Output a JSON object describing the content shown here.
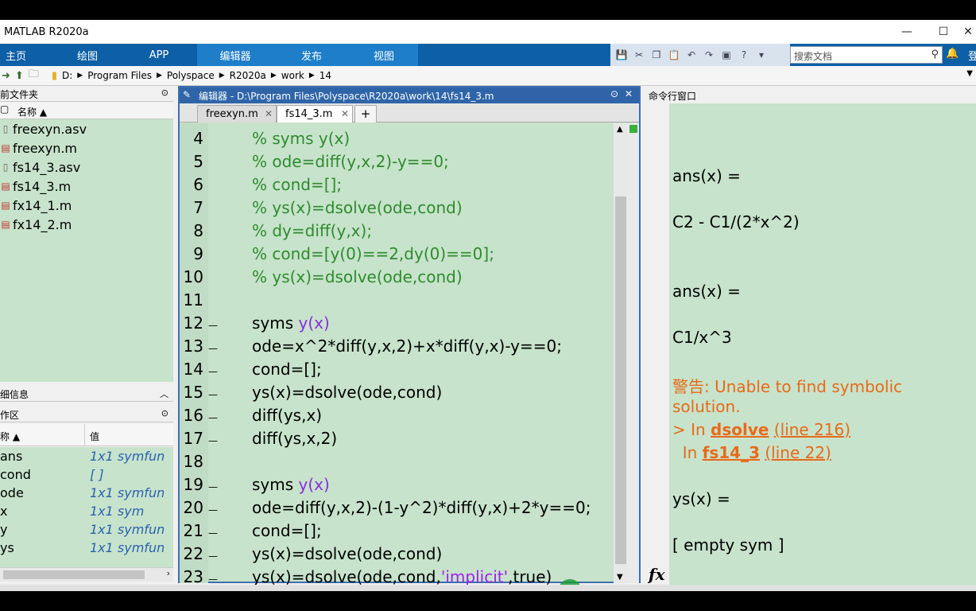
{
  "window": {
    "title": "MATLAB R2020a"
  },
  "ribbon": {
    "tabs": [
      "主页",
      "绘图",
      "APP",
      "编辑器",
      "发布",
      "视图"
    ],
    "active": 3,
    "search_placeholder": "搜索文档",
    "login": "登"
  },
  "address": {
    "crumbs": [
      "D:",
      "Program Files",
      "Polyspace",
      "R2020a",
      "work",
      "14"
    ]
  },
  "file_browser": {
    "title": "前文件夹",
    "column": "名称 ▲",
    "files": [
      "freexyn.asv",
      "freexyn.m",
      "fs14_3.asv",
      "fs14_3.m",
      "fx14_1.m",
      "fx14_2.m"
    ]
  },
  "details": {
    "title": "细信息"
  },
  "workspace": {
    "title": "作区",
    "col_name": "称 ▲",
    "col_value": "值",
    "vars": [
      {
        "name": "ans",
        "value": "1x1 symfun"
      },
      {
        "name": "cond",
        "value": "[ ]"
      },
      {
        "name": "ode",
        "value": "1x1 symfun"
      },
      {
        "name": "x",
        "value": "1x1 sym"
      },
      {
        "name": "y",
        "value": "1x1 symfun"
      },
      {
        "name": "ys",
        "value": "1x1 symfun"
      }
    ]
  },
  "editor": {
    "title": "编辑器 - D:\\Program Files\\Polyspace\\R2020a\\work\\14\\fs14_3.m",
    "tabs": [
      "freexyn.m",
      "fs14_3.m",
      "+"
    ],
    "active_tab": 1,
    "lines": [
      {
        "n": "4",
        "dash": "",
        "parts": [
          {
            "t": "% syms y(x)",
            "c": "cm"
          }
        ]
      },
      {
        "n": "5",
        "dash": "",
        "parts": [
          {
            "t": "% ode=diff(y,x,2)-y==0;",
            "c": "cm"
          }
        ]
      },
      {
        "n": "6",
        "dash": "",
        "parts": [
          {
            "t": "% cond=[];",
            "c": "cm"
          }
        ]
      },
      {
        "n": "7",
        "dash": "",
        "parts": [
          {
            "t": "% ys(x)=dsolve(ode,cond)",
            "c": "cm"
          }
        ]
      },
      {
        "n": "8",
        "dash": "",
        "parts": [
          {
            "t": "% dy=diff(y,x);",
            "c": "cm"
          }
        ]
      },
      {
        "n": "9",
        "dash": "",
        "parts": [
          {
            "t": "% cond=[y(0)==2,dy(0)==0];",
            "c": "cm"
          }
        ]
      },
      {
        "n": "10",
        "dash": "",
        "parts": [
          {
            "t": "% ys(x)=dsolve(ode,cond)",
            "c": "cm"
          }
        ]
      },
      {
        "n": "11",
        "dash": "",
        "parts": []
      },
      {
        "n": "12",
        "dash": "—",
        "parts": [
          {
            "t": "syms ",
            "c": ""
          },
          {
            "t": "y(x)",
            "c": "sv"
          }
        ]
      },
      {
        "n": "13",
        "dash": "—",
        "parts": [
          {
            "t": "ode=x^2*diff(y,x,2)+x*diff(y,x)-y==0;",
            "c": ""
          }
        ]
      },
      {
        "n": "14",
        "dash": "—",
        "parts": [
          {
            "t": "cond=[];",
            "c": ""
          }
        ]
      },
      {
        "n": "15",
        "dash": "—",
        "parts": [
          {
            "t": "ys(x)=dsolve(ode,cond)",
            "c": ""
          }
        ]
      },
      {
        "n": "16",
        "dash": "—",
        "parts": [
          {
            "t": "diff(ys,x)",
            "c": ""
          }
        ]
      },
      {
        "n": "17",
        "dash": "—",
        "parts": [
          {
            "t": "diff(ys,x,2)",
            "c": ""
          }
        ]
      },
      {
        "n": "18",
        "dash": "",
        "parts": []
      },
      {
        "n": "19",
        "dash": "—",
        "parts": [
          {
            "t": "syms ",
            "c": ""
          },
          {
            "t": "y(x)",
            "c": "sv"
          }
        ]
      },
      {
        "n": "20",
        "dash": "—",
        "parts": [
          {
            "t": "ode=diff(y,x,2)-(1-y^2)*diff(y,x)+2*y==0;",
            "c": ""
          }
        ]
      },
      {
        "n": "21",
        "dash": "—",
        "parts": [
          {
            "t": "cond=[];",
            "c": ""
          }
        ]
      },
      {
        "n": "22",
        "dash": "—",
        "parts": [
          {
            "t": "ys(x)=dsolve(ode,cond)",
            "c": ""
          }
        ]
      },
      {
        "n": "23",
        "dash": "—",
        "parts": [
          {
            "t": "ys(x)=dsolve(ode,cond,",
            "c": ""
          },
          {
            "t": "'implicit'",
            "c": "st"
          },
          {
            "t": ",true)",
            "c": ""
          }
        ]
      }
    ]
  },
  "command_window": {
    "title": "命令行窗口",
    "lines": [
      {
        "t": "ans(x) =",
        "c": ""
      },
      {
        "t": "C2 - C1/(2*x^2)",
        "c": ""
      },
      {
        "t": "ans(x) =",
        "c": ""
      },
      {
        "t": "C1/x^3",
        "c": ""
      },
      {
        "t": "警告: Unable to find symbolic",
        "c": "warn"
      },
      {
        "t": "solution.",
        "c": "warn"
      },
      {
        "t": "ys(x) =",
        "c": ""
      },
      {
        "t": "[ empty sym ]",
        "c": ""
      }
    ],
    "trace1": {
      "prefix": "> In ",
      "fn": "dsolve",
      "loc": "(line 216)"
    },
    "trace2": {
      "prefix": "  In ",
      "fn": "fs14_3",
      "loc": "(line 22)"
    },
    "prompt": ">>",
    "fx": "fx"
  },
  "colors": {
    "ribbon": "#0d5fa6",
    "panel_bg": "#c7e3cb",
    "comment": "#2e8b2e",
    "string": "#a020f0",
    "warning": "#e86a1a"
  }
}
